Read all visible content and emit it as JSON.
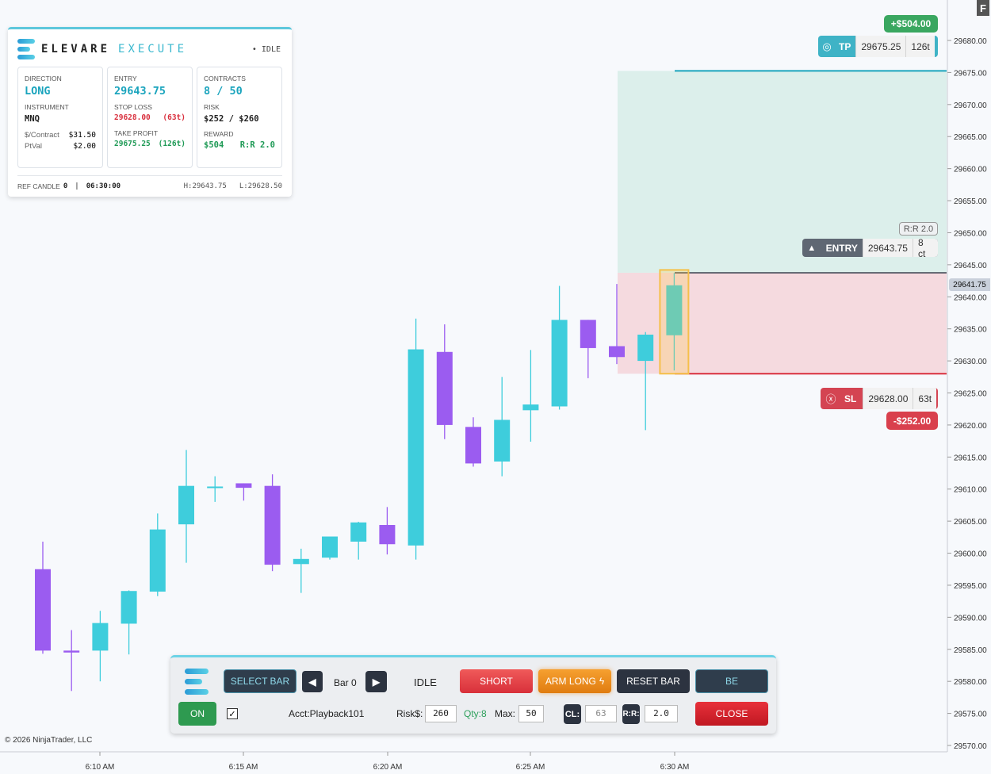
{
  "panel": {
    "brand": "ELEVARE",
    "brand_sub": "EXECUTE",
    "status": "• IDLE",
    "direction_label": "DIRECTION",
    "direction": "LONG",
    "instrument_label": "INSTRUMENT",
    "instrument": "MNQ",
    "per_contract_label": "$/Contract",
    "per_contract": "$31.50",
    "ptval_label": "PtVal",
    "ptval": "$2.00",
    "entry_label": "ENTRY",
    "entry": "29643.75",
    "stop_label": "STOP LOSS",
    "stop": "29628.00",
    "stop_ticks": "(63t)",
    "tp_label": "TAKE PROFIT",
    "tp": "29675.25",
    "tp_ticks": "(126t)",
    "contracts_label": "CONTRACTS",
    "contracts": "8 / 50",
    "risk_label": "RISK",
    "risk": "$252 / $260",
    "reward_label": "REWARD",
    "reward": "$504",
    "rr": "R:R 2.0",
    "ref_label": "REF CANDLE",
    "ref_value": "0",
    "time": "06:30:00",
    "high": "H:29643.75",
    "low": "L:29628.50"
  },
  "tags": {
    "profit_pill": "+$504.00",
    "tp_label": "TP",
    "tp_price": "29675.25",
    "tp_ticks": "126t",
    "rr_badge": "R:R 2.0",
    "entry_label": "ENTRY",
    "entry_price": "29643.75",
    "entry_qty": "8 ct",
    "sl_label": "SL",
    "sl_price": "29628.00",
    "sl_ticks": "63t",
    "loss_pill": "-$252.00",
    "current_price": "29641.75"
  },
  "controls": {
    "select_bar": "SELECT BAR",
    "bar_label": "Bar 0",
    "state": "IDLE",
    "short": "SHORT",
    "arm_long": "ARM LONG",
    "reset_bar": "RESET BAR",
    "be": "BE",
    "on": "ON",
    "account": "Acct:Playback101",
    "risk_label": "Risk$:",
    "risk_value": "260",
    "qty": "Qty:8",
    "max_label": "Max:",
    "max_value": "50",
    "cl_label": "CL:",
    "cl_value": "63",
    "rr_label": "R:R:",
    "rr_value": "2.0",
    "close": "CLOSE"
  },
  "copyright": "© 2026 NinjaTrader, LLC",
  "f_button": "F",
  "colors": {
    "bull": "#3ecddc",
    "bear": "#9b5cf0",
    "tp_zone": "#dcefeb",
    "sl_zone": "#f5dadf",
    "tp_line": "#1aa4bd",
    "sl_line": "#d9303e"
  },
  "chart_data": {
    "type": "candlestick",
    "y_ticks": [
      "29680.00",
      "29675.00",
      "29670.00",
      "29665.00",
      "29660.00",
      "29655.00",
      "29650.00",
      "29645.00",
      "29640.00",
      "29635.00",
      "29630.00",
      "29625.00",
      "29620.00",
      "29615.00",
      "29610.00",
      "29605.00",
      "29600.00",
      "29595.00",
      "29590.00",
      "29585.00",
      "29580.00",
      "29575.00",
      "29570.00"
    ],
    "ylim": [
      29570,
      29680
    ],
    "x_ticks": [
      "6:10 AM",
      "6:15 AM",
      "6:20 AM",
      "6:25 AM",
      "6:30 AM"
    ],
    "entry": 29643.75,
    "stop": 29628.0,
    "target": 29675.25,
    "candles": [
      {
        "o": 29597.5,
        "h": 29601.8,
        "l": 29584.3,
        "c": 29584.8
      },
      {
        "o": 29584.8,
        "h": 29588.0,
        "l": 29578.5,
        "c": 29584.5
      },
      {
        "o": 29584.8,
        "h": 29591.0,
        "l": 29580.0,
        "c": 29589.1
      },
      {
        "o": 29589.0,
        "h": 29594.2,
        "l": 29584.2,
        "c": 29594.1
      },
      {
        "o": 29594.0,
        "h": 29606.2,
        "l": 29593.3,
        "c": 29603.7
      },
      {
        "o": 29604.5,
        "h": 29616.1,
        "l": 29598.5,
        "c": 29610.5
      },
      {
        "o": 29610.3,
        "h": 29612.0,
        "l": 29608.0,
        "c": 29610.4
      },
      {
        "o": 29610.9,
        "h": 29610.9,
        "l": 29608.2,
        "c": 29610.2
      },
      {
        "o": 29610.5,
        "h": 29612.3,
        "l": 29597.2,
        "c": 29598.2
      },
      {
        "o": 29598.3,
        "h": 29600.7,
        "l": 29593.8,
        "c": 29599.1
      },
      {
        "o": 29599.3,
        "h": 29602.4,
        "l": 29599.0,
        "c": 29602.6
      },
      {
        "o": 29601.8,
        "h": 29604.9,
        "l": 29599.0,
        "c": 29604.8
      },
      {
        "o": 29604.4,
        "h": 29607.2,
        "l": 29599.8,
        "c": 29601.4
      },
      {
        "o": 29601.2,
        "h": 29636.6,
        "l": 29599.0,
        "c": 29631.8
      },
      {
        "o": 29631.4,
        "h": 29635.7,
        "l": 29617.8,
        "c": 29620.0
      },
      {
        "o": 29619.7,
        "h": 29621.2,
        "l": 29613.5,
        "c": 29614.0
      },
      {
        "o": 29614.3,
        "h": 29627.5,
        "l": 29612.0,
        "c": 29620.8
      },
      {
        "o": 29622.3,
        "h": 29631.7,
        "l": 29617.4,
        "c": 29623.2
      },
      {
        "o": 29622.9,
        "h": 29641.7,
        "l": 29622.4,
        "c": 29636.4
      },
      {
        "o": 29636.4,
        "h": 29636.4,
        "l": 29627.3,
        "c": 29632.0
      },
      {
        "o": 29632.3,
        "h": 29642.0,
        "l": 29629.5,
        "c": 29630.6
      },
      {
        "o": 29630.0,
        "h": 29634.5,
        "l": 29619.2,
        "c": 29634.1
      },
      {
        "o": 29634.0,
        "h": 29643.7,
        "l": 29628.5,
        "c": 29641.8
      }
    ]
  }
}
